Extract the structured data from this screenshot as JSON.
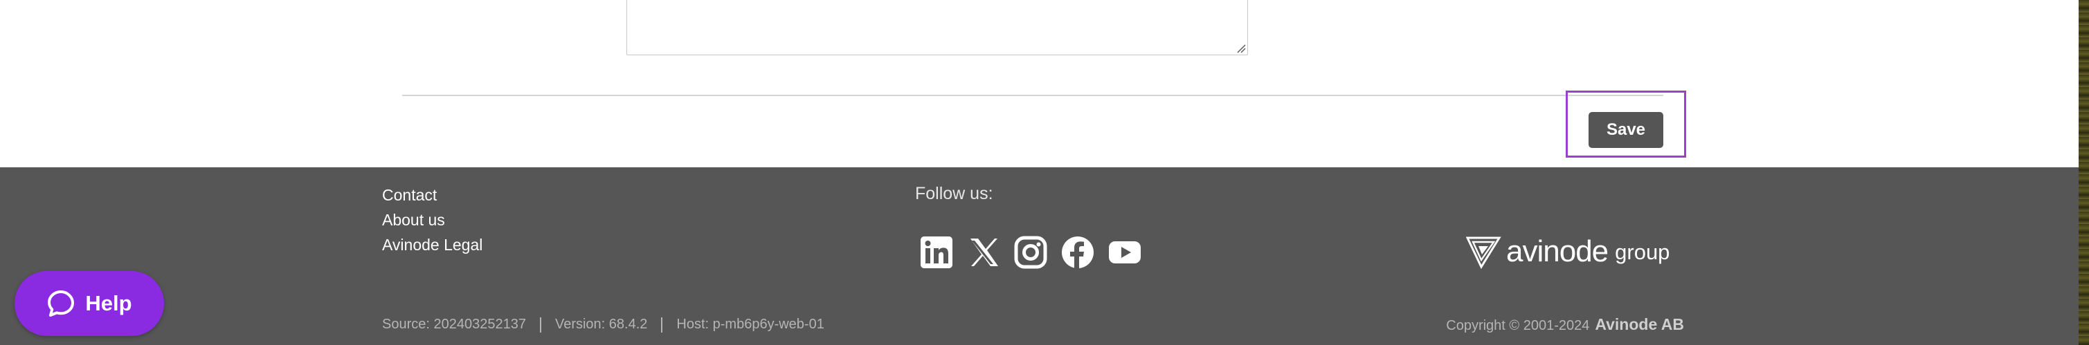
{
  "form": {
    "save_label": "Save"
  },
  "footer": {
    "links": [
      {
        "label": "Contact"
      },
      {
        "label": "About us"
      },
      {
        "label": "Avinode Legal"
      }
    ],
    "follow_label": "Follow us:",
    "socials": [
      {
        "name": "LinkedIn",
        "icon": "linkedin-icon"
      },
      {
        "name": "X",
        "icon": "x-icon"
      },
      {
        "name": "Instagram",
        "icon": "instagram-icon"
      },
      {
        "name": "Facebook",
        "icon": "facebook-icon"
      },
      {
        "name": "YouTube",
        "icon": "youtube-icon"
      }
    ],
    "logo": {
      "word": "avinode",
      "suffix": "group"
    },
    "meta": {
      "source": "Source: 202403252137",
      "version": "Version: 68.4.2",
      "host": "Host: p-mb6p6y-web-01"
    },
    "copyright": {
      "text": "Copyright © 2001-2024",
      "company": "Avinode AB"
    }
  },
  "help": {
    "label": "Help"
  },
  "colors": {
    "footer_bg": "#565656",
    "save_bg": "#555555",
    "focus_outline": "#9a3fd6",
    "help_bg": "#8a2be2"
  }
}
